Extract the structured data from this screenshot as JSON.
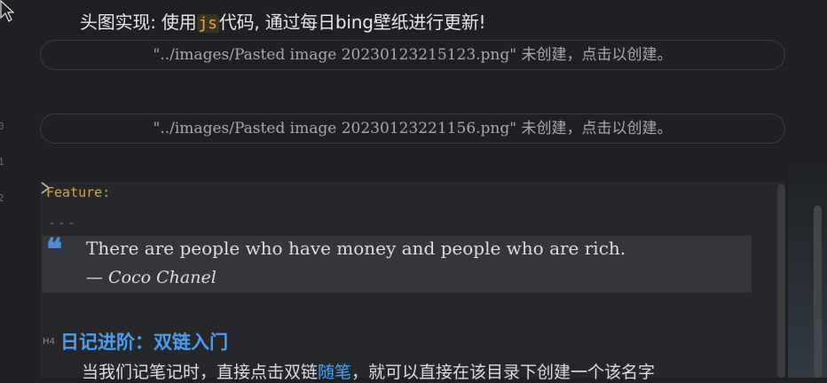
{
  "gutter": {
    "line_numbers": [
      "0",
      "1",
      "2"
    ]
  },
  "heading": {
    "before": "头图实现: 使用",
    "code": "js",
    "after": "代码, 通过每日bing壁纸进行更新!"
  },
  "placeholders": [
    "\"../images/Pasted image 20230123215123.png\" 未创建，点击以创建。",
    "\"../images/Pasted image 20230123221156.png\" 未创建，点击以创建。"
  ],
  "frontmatter": {
    "feature": "Feature:",
    "separator": "---"
  },
  "quote": {
    "mark": "❝",
    "text": "There are people who have money and people who are rich.",
    "author": "— Coco Chanel"
  },
  "section": {
    "tag": "H4",
    "title": "日记进阶：双链入门",
    "body_before": "当我们记笔记时，直接点击双链",
    "body_link": "随笔",
    "body_after": "，就可以直接在该目录下创建一个该名字"
  },
  "colors": {
    "accent": "#4b9ef0",
    "code": "#f0a33a",
    "background": "#1e2023"
  }
}
